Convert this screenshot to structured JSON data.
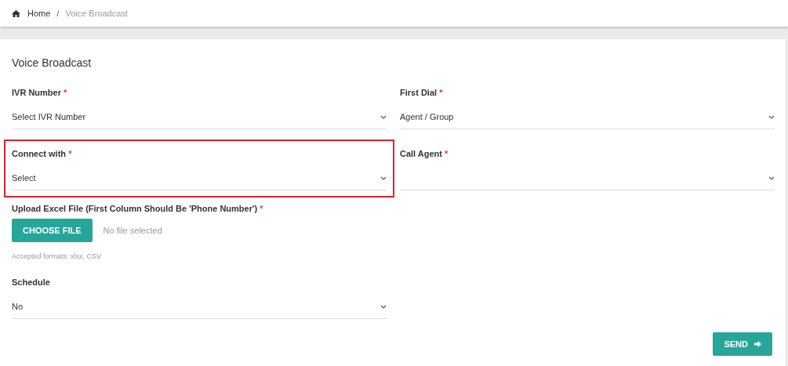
{
  "breadcrumb": [
    {
      "label": "Home",
      "kind": "home"
    },
    {
      "label": "/",
      "kind": "separator"
    },
    {
      "label": "Voice Broadcast",
      "kind": "current"
    }
  ],
  "form": {
    "title": "Voice Broadcast",
    "fields": [
      {
        "label": "IVR Number",
        "required_mark": "*",
        "value": "Select IVR Number",
        "highlighted": false
      },
      {
        "label": "First Dial",
        "required_mark": "*",
        "value": "Agent / Group",
        "highlighted": false
      },
      {
        "label": "Connect with",
        "required_mark": "*",
        "value": "Select",
        "highlighted": true
      },
      {
        "label": "Call Agent",
        "required_mark": "*",
        "highlighted": false
      }
    ],
    "upload": {
      "label": "Upload Excel File (First Column Should Be 'Phone Number')",
      "required_mark": "*",
      "button": "CHOOSE FILE",
      "status": "No file selected",
      "hint": "Accepted formats: xlsx, CSV"
    },
    "schedule": {
      "label": "Schedule",
      "value": "No",
      "highlighted": false
    },
    "submit": "SEND"
  }
}
